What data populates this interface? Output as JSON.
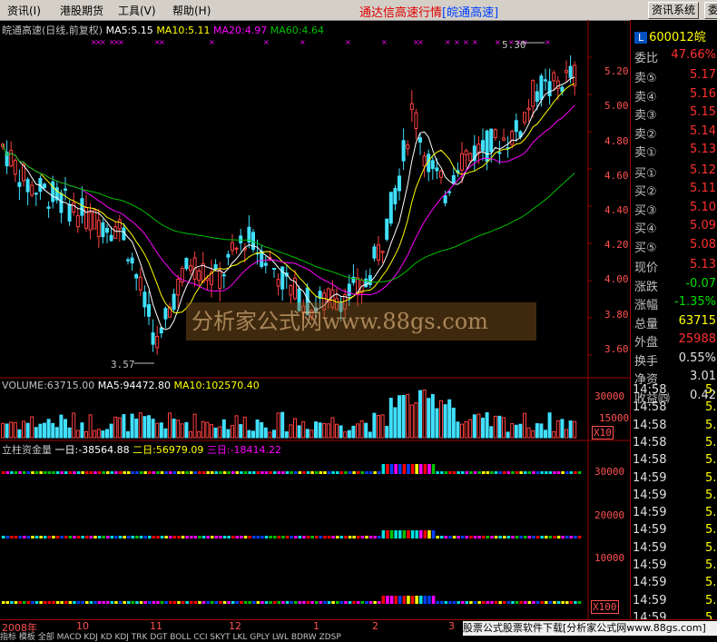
{
  "menu": {
    "items": [
      "资讯(I)",
      "港股期货",
      "工具(V)",
      "帮助(H)"
    ],
    "title": "通达信高速行情",
    "title_stock": "[皖通高速]",
    "buttons": [
      "资讯系统",
      "委"
    ]
  },
  "chart_header": {
    "name": "皖通高速(日线,前复权)",
    "ma5": "MA5:5.15",
    "ma10": "MA10:5.11",
    "ma20": "MA20:4.97",
    "ma60": "MA60:4.64",
    "colors": {
      "ma5": "#ffffff",
      "ma10": "#ffff00",
      "ma20": "#ff00ff",
      "ma60": "#00c000"
    }
  },
  "chart_data": [
    {
      "type": "line",
      "title": "皖通高速(日线,前复权)",
      "ylim": [
        3.5,
        5.3
      ],
      "yticks": [
        "5.20",
        "5.00",
        "4.80",
        "4.60",
        "4.40",
        "4.20",
        "4.00",
        "3.80",
        "3.60"
      ],
      "annotations": [
        "5.30",
        "3.57"
      ],
      "series": [
        {
          "name": "MA5",
          "color": "#ffffff"
        },
        {
          "name": "MA10",
          "color": "#ffff00"
        },
        {
          "name": "MA20",
          "color": "#ff00ff"
        },
        {
          "name": "MA60",
          "color": "#00c000"
        }
      ]
    },
    {
      "type": "bar",
      "title": "VOLUME:63715.00",
      "ma5": "MA5:94472.80",
      "ma10": "MA10:102570.40",
      "yticks": [
        "30000",
        "15000"
      ],
      "unit": "X10"
    },
    {
      "type": "bar",
      "title": "立柱资金量",
      "d1": "一日:-38564.88",
      "d2": "二日:56979.09",
      "d3": "三日:-18414.22",
      "yticks": [
        "30000",
        "20000",
        "10000"
      ],
      "unit": "X100"
    }
  ],
  "x_axis": {
    "labels": [
      "2008年",
      "10",
      "11",
      "12",
      "1",
      "2",
      "3"
    ]
  },
  "watermark": "分析家公式网www.88gs.com",
  "quote": {
    "code": "600012",
    "code_suffix": "皖",
    "weibi_label": "委比",
    "weibi": "47.66%",
    "sell": [
      {
        "label": "卖⑤",
        "price": "5.17"
      },
      {
        "label": "卖④",
        "price": "5.16"
      },
      {
        "label": "卖③",
        "price": "5.15"
      },
      {
        "label": "卖②",
        "price": "5.14"
      },
      {
        "label": "卖①",
        "price": "5.13"
      }
    ],
    "buy": [
      {
        "label": "买①",
        "price": "5.12"
      },
      {
        "label": "买②",
        "price": "5.11"
      },
      {
        "label": "买③",
        "price": "5.10"
      },
      {
        "label": "买④",
        "price": "5.09"
      },
      {
        "label": "买⑤",
        "price": "5.08"
      }
    ],
    "stats": [
      {
        "label": "现价",
        "value": "5.13",
        "cls": "red"
      },
      {
        "label": "涨跌",
        "value": "-0.07",
        "cls": "green"
      },
      {
        "label": "涨幅",
        "value": "-1.35%",
        "cls": "green"
      },
      {
        "label": "总量",
        "value": "63715",
        "cls": "yellow"
      },
      {
        "label": "外盘",
        "value": "25988",
        "cls": "red"
      },
      {
        "label": "换手",
        "value": "0.55%",
        "cls": "white"
      },
      {
        "label": "净资",
        "value": "3.01",
        "cls": "white"
      },
      {
        "label": "收益㈣",
        "value": "0.42",
        "cls": "white"
      }
    ],
    "ticks": [
      {
        "time": "14:58",
        "val": "5."
      },
      {
        "time": "14:58",
        "val": "5."
      },
      {
        "time": "14:58",
        "val": "5."
      },
      {
        "time": "14:58",
        "val": "5."
      },
      {
        "time": "14:58",
        "val": "5."
      },
      {
        "time": "14:59",
        "val": "5."
      },
      {
        "time": "14:59",
        "val": "5."
      },
      {
        "time": "14:59",
        "val": "5."
      },
      {
        "time": "14:59",
        "val": "5."
      },
      {
        "time": "14:59",
        "val": "5."
      },
      {
        "time": "14:59",
        "val": "5."
      },
      {
        "time": "14:59",
        "val": "5."
      },
      {
        "time": "14:59",
        "val": "5."
      },
      {
        "time": "14:59",
        "val": "5."
      }
    ]
  },
  "bottom_tabs": "指标  模板  全部  MACD  KDJ  KD  KDJ  TRK  DGT  BOLL  CCI  SKYT  LKL  GPLY  LWL  BDRW  ZDSP",
  "banner": "股票公式股票软件下载[分析家公式网www.88gs.com]"
}
